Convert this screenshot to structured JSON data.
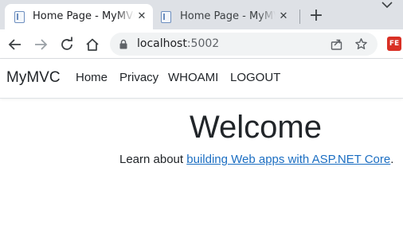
{
  "browser": {
    "tabs": [
      {
        "title": "Home Page - MyMVC",
        "active": true
      },
      {
        "title": "Home Page - MyMVC",
        "active": false
      }
    ],
    "close_glyph": "✕",
    "new_tab_glyph": "+",
    "url_host": "localhost",
    "url_port": ":5002",
    "extension_label": "FE"
  },
  "site": {
    "brand": "MyMVC",
    "nav": [
      "Home",
      "Privacy",
      "WHOAMI",
      "LOGOUT"
    ]
  },
  "main": {
    "heading": "Welcome",
    "learn_prefix": "Learn about ",
    "learn_link": "building Web apps with ASP.NET Core",
    "learn_suffix": "."
  },
  "colors": {
    "tabstrip": "#dee1e6",
    "omnibox": "#f1f3f4",
    "link": "#1b6ec2",
    "text": "#212529"
  },
  "icons": [
    "page-favicon-icon",
    "close-icon",
    "plus-icon",
    "chevron-down-icon",
    "back-arrow-icon",
    "forward-arrow-icon",
    "reload-icon",
    "home-icon",
    "lock-icon",
    "share-icon",
    "star-icon",
    "extension-icon"
  ]
}
